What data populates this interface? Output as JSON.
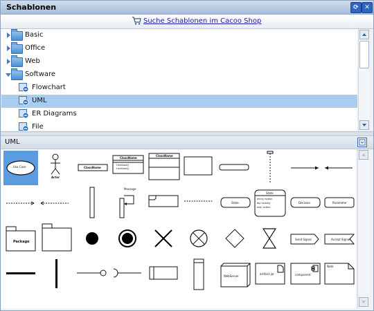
{
  "window": {
    "title": "Schablonen",
    "restore_icon": "restore-icon",
    "close_icon": "close-icon"
  },
  "shop": {
    "icon": "cart-icon",
    "link_label": "Suche Schablonen im Cacoo Shop"
  },
  "tree": {
    "items": [
      {
        "label": "Basic",
        "type": "folder",
        "expanded": false
      },
      {
        "label": "Office",
        "type": "folder",
        "expanded": false
      },
      {
        "label": "Web",
        "type": "folder",
        "expanded": false
      },
      {
        "label": "Software",
        "type": "folder",
        "expanded": true
      },
      {
        "label": "Flowchart",
        "type": "template"
      },
      {
        "label": "UML",
        "type": "template",
        "selected": true
      },
      {
        "label": "ER Diagrams",
        "type": "template"
      },
      {
        "label": "File",
        "type": "template"
      }
    ]
  },
  "panel": {
    "title": "UML",
    "action_icon": "panel-toggle-icon"
  },
  "shapes": {
    "usecase": "Use Case",
    "actor": "Actor",
    "class_name": "ClassName",
    "class_name2": "ClassName",
    "class_name3": "ClassName",
    "method_line1": "+method()",
    "method_line2": "+method()",
    "message": "Message",
    "state": "State",
    "state2": "State",
    "state_line1": "entry/ action",
    "state_line2": "do/ activity",
    "state_line3": "exit/ action",
    "decision": "Decision",
    "parameter": "Parameter",
    "package": "Package",
    "send_signal": "Send Signal",
    "accept_signal": "Accept Signal",
    "webserver": "WebServer",
    "artifact": "artifact.jar",
    "component": "component",
    "note": "Note"
  },
  "accent": "#5b9be0"
}
